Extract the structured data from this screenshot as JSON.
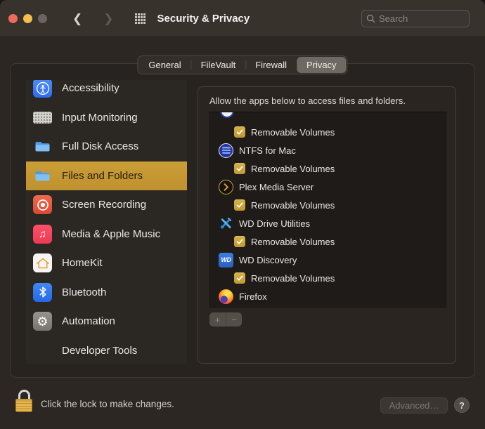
{
  "window": {
    "title": "Security & Privacy",
    "search_placeholder": "Search"
  },
  "tabs": [
    {
      "label": "General",
      "selected": false
    },
    {
      "label": "FileVault",
      "selected": false
    },
    {
      "label": "Firewall",
      "selected": false
    },
    {
      "label": "Privacy",
      "selected": true
    }
  ],
  "sidebar": {
    "items": [
      {
        "label": "Accessibility",
        "icon": "accessibility",
        "selected": false
      },
      {
        "label": "Input Monitoring",
        "icon": "keyboard",
        "selected": false
      },
      {
        "label": "Full Disk Access",
        "icon": "folder",
        "selected": false
      },
      {
        "label": "Files and Folders",
        "icon": "folder",
        "selected": true
      },
      {
        "label": "Screen Recording",
        "icon": "screen-recording",
        "selected": false
      },
      {
        "label": "Media & Apple Music",
        "icon": "music-note",
        "selected": false
      },
      {
        "label": "HomeKit",
        "icon": "home",
        "selected": false
      },
      {
        "label": "Bluetooth",
        "icon": "bluetooth",
        "selected": false
      },
      {
        "label": "Automation",
        "icon": "gear",
        "selected": false
      },
      {
        "label": "Developer Tools",
        "icon": "none",
        "selected": false
      }
    ]
  },
  "privacy_panel": {
    "header": "Allow the apps below to access files and folders.",
    "rows": [
      {
        "type": "clipped-app",
        "icon": "clipped-circle",
        "label": ""
      },
      {
        "type": "permission",
        "label": "Removable Volumes",
        "checked": true
      },
      {
        "type": "app",
        "label": "NTFS for Mac",
        "icon": "ntfs"
      },
      {
        "type": "permission",
        "label": "Removable Volumes",
        "checked": true
      },
      {
        "type": "app",
        "label": "Plex Media Server",
        "icon": "plex"
      },
      {
        "type": "permission",
        "label": "Removable Volumes",
        "checked": true
      },
      {
        "type": "app",
        "label": "WD Drive Utilities",
        "icon": "wd-tools"
      },
      {
        "type": "permission",
        "label": "Removable Volumes",
        "checked": true
      },
      {
        "type": "app",
        "label": "WD Discovery",
        "icon": "wd-badge"
      },
      {
        "type": "permission",
        "label": "Removable Volumes",
        "checked": true
      },
      {
        "type": "app",
        "label": "Firefox",
        "icon": "firefox"
      }
    ],
    "add_label": "+",
    "remove_label": "−"
  },
  "footer": {
    "lock_hint": "Click the lock to make changes.",
    "advanced_label": "Advanced…",
    "help_label": "?"
  },
  "colors": {
    "selection_gold": "#c89b33",
    "checkbox_gold": "#c9a23b",
    "traffic_red": "#ed6a5f",
    "traffic_yellow": "#f5bf4f",
    "traffic_gray": "#6a6560"
  }
}
